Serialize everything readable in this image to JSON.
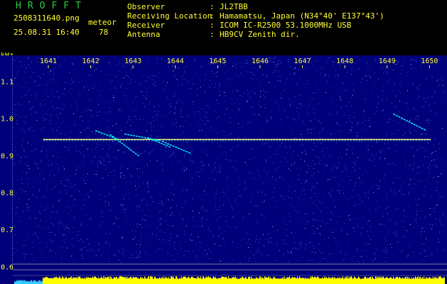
{
  "app": {
    "title": "HROFFT"
  },
  "file": {
    "name": "2508311640.png",
    "datetime": "25.08.31 16:40"
  },
  "meteor": {
    "label": "meteor",
    "count": "78"
  },
  "info": [
    {
      "key": "Observer",
      "sep": ":",
      "value": "JL2TBB"
    },
    {
      "key": "Receiving Location",
      "sep": ":",
      "value": "Hamamatsu, Japan (N34°40' E137°43')"
    },
    {
      "key": "Receiver",
      "sep": ":",
      "value": "ICOM IC-R2500 53.1000MHz USB"
    },
    {
      "key": "Antenna",
      "sep": ":",
      "value": "HB9CV Zenith dir."
    }
  ],
  "colors": {
    "background": "#00007a",
    "text": "#ffff33",
    "title": "#2ecc40",
    "noise": "#4a7cff",
    "trace": "#00ffff",
    "carrier": "#ffff66",
    "bars": "#ffff00"
  },
  "chart_data": {
    "type": "heatmap",
    "ylabel": "kHz",
    "x_ticks": [
      "1641",
      "1642",
      "1643",
      "1644",
      "1645",
      "1646",
      "1647",
      "1648",
      "1649",
      "1650"
    ],
    "y_ticks": [
      "1.1",
      "1.0",
      "0.9",
      "0.8",
      "0.7",
      "0.6"
    ],
    "xlim": [
      1640.65,
      1650.0
    ],
    "ylim": [
      0.595,
      1.17
    ],
    "carrier": {
      "y": 0.943,
      "x_start": 1640.7,
      "x_end": 1650.0
    },
    "meteor_traces": [
      {
        "x": [
          1641.95,
          1642.5
        ],
        "y": [
          0.967,
          0.943
        ]
      },
      {
        "x": [
          1642.3,
          1643.0
        ],
        "y": [
          0.957,
          0.898
        ]
      },
      {
        "x": [
          1642.65,
          1643.5
        ],
        "y": [
          0.958,
          0.94
        ]
      },
      {
        "x": [
          1643.2,
          1643.75
        ],
        "y": [
          0.948,
          0.922
        ]
      },
      {
        "x": [
          1643.55,
          1644.25
        ],
        "y": [
          0.938,
          0.905
        ]
      },
      {
        "x": [
          1649.1,
          1649.9
        ],
        "y": [
          1.012,
          0.967
        ]
      }
    ]
  }
}
